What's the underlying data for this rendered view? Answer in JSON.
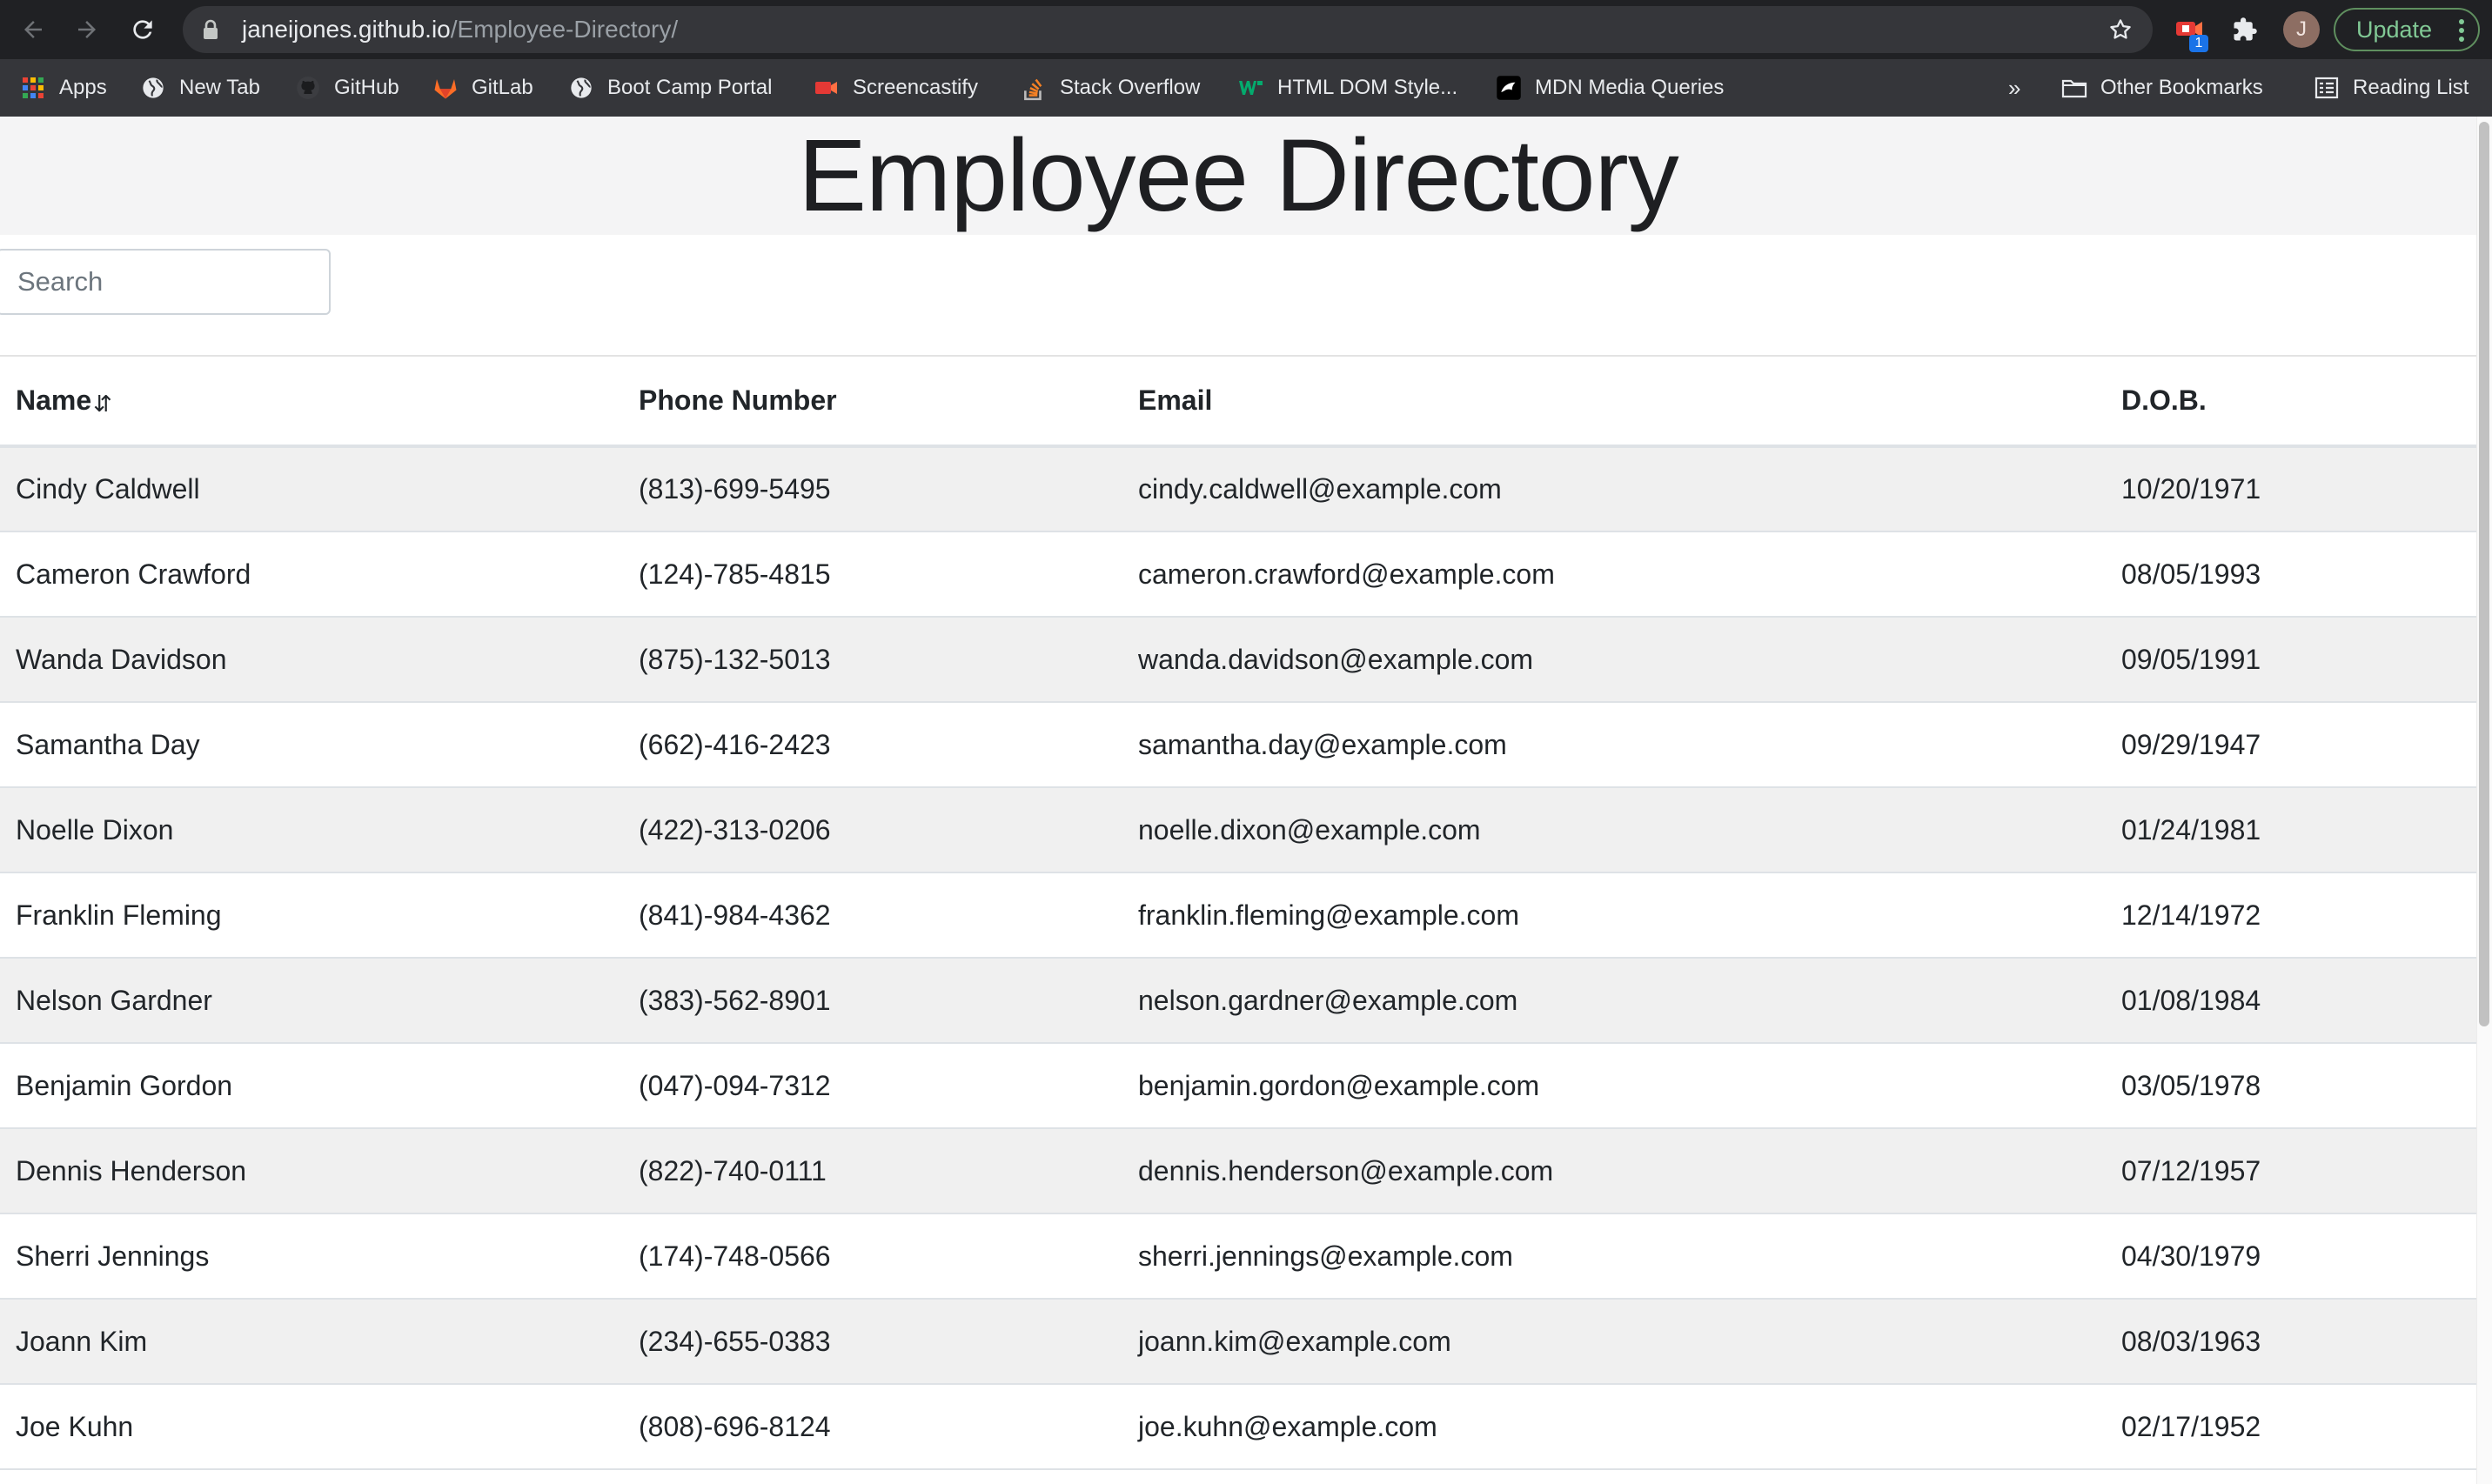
{
  "browser": {
    "url_host": "janeijones.github.io",
    "url_path": "/Employee-Directory/",
    "extension_badge": "1",
    "profile_initial": "J",
    "update_label": "Update",
    "bookmarks": [
      {
        "label": "Apps",
        "icon": "apps-grid-icon"
      },
      {
        "label": "New Tab",
        "icon": "globe-icon"
      },
      {
        "label": "GitHub",
        "icon": "github-icon"
      },
      {
        "label": "GitLab",
        "icon": "gitlab-icon"
      },
      {
        "label": "Boot Camp Portal",
        "icon": "globe-icon"
      },
      {
        "label": "Screencastify",
        "icon": "screencastify-icon"
      },
      {
        "label": "Stack Overflow",
        "icon": "stackoverflow-icon"
      },
      {
        "label": "HTML DOM Style...",
        "icon": "w3schools-icon"
      },
      {
        "label": "MDN Media Queries",
        "icon": "mdn-icon"
      }
    ],
    "overflow_chevron": "»",
    "other_bookmarks": "Other Bookmarks",
    "reading_list": "Reading List"
  },
  "page": {
    "title": "Employee Directory",
    "search_placeholder": "Search"
  },
  "table": {
    "headers": {
      "name": "Name",
      "sort_glyph": "⇵",
      "phone": "Phone Number",
      "email": "Email",
      "dob": "D.O.B."
    },
    "rows": [
      {
        "name": "Cindy Caldwell",
        "phone": "(813)-699-5495",
        "email": "cindy.caldwell@example.com",
        "dob": "10/20/1971"
      },
      {
        "name": "Cameron Crawford",
        "phone": "(124)-785-4815",
        "email": "cameron.crawford@example.com",
        "dob": "08/05/1993"
      },
      {
        "name": "Wanda Davidson",
        "phone": "(875)-132-5013",
        "email": "wanda.davidson@example.com",
        "dob": "09/05/1991"
      },
      {
        "name": "Samantha Day",
        "phone": "(662)-416-2423",
        "email": "samantha.day@example.com",
        "dob": "09/29/1947"
      },
      {
        "name": "Noelle Dixon",
        "phone": "(422)-313-0206",
        "email": "noelle.dixon@example.com",
        "dob": "01/24/1981"
      },
      {
        "name": "Franklin Fleming",
        "phone": "(841)-984-4362",
        "email": "franklin.fleming@example.com",
        "dob": "12/14/1972"
      },
      {
        "name": "Nelson Gardner",
        "phone": "(383)-562-8901",
        "email": "nelson.gardner@example.com",
        "dob": "01/08/1984"
      },
      {
        "name": "Benjamin Gordon",
        "phone": "(047)-094-7312",
        "email": "benjamin.gordon@example.com",
        "dob": "03/05/1978"
      },
      {
        "name": "Dennis Henderson",
        "phone": "(822)-740-0111",
        "email": "dennis.henderson@example.com",
        "dob": "07/12/1957"
      },
      {
        "name": "Sherri Jennings",
        "phone": "(174)-748-0566",
        "email": "sherri.jennings@example.com",
        "dob": "04/30/1979"
      },
      {
        "name": "Joann Kim",
        "phone": "(234)-655-0383",
        "email": "joann.kim@example.com",
        "dob": "08/03/1963"
      },
      {
        "name": "Joe Kuhn",
        "phone": "(808)-696-8124",
        "email": "joe.kuhn@example.com",
        "dob": "02/17/1952"
      }
    ]
  },
  "colors": {
    "chrome_dark": "#202124",
    "bookmarks_bar": "#35363a",
    "update_green": "#81c995",
    "striped_row": "#f0f0f0",
    "jumbotron": "#f4f4f5"
  }
}
